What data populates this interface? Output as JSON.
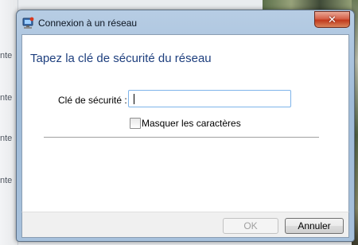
{
  "dialog": {
    "title": "Connexion à un réseau",
    "close_symbol": "✕",
    "heading": "Tapez la clé de sécurité du réseau",
    "security_key": {
      "label": "Clé de sécurité :",
      "value": "",
      "placeholder": ""
    },
    "hide_characters": {
      "label": "Masquer les caractères",
      "checked": false
    },
    "buttons": {
      "ok": "OK",
      "cancel": "Annuler"
    }
  },
  "background": {
    "left_snippets": [
      "nte",
      "nte",
      "nte",
      "nte"
    ]
  },
  "colors": {
    "heading": "#1e3f7e",
    "close_button": "#c0391c",
    "input_border": "#7eb4ea"
  },
  "icons": {
    "title": "network-connection-icon",
    "close": "close-icon"
  }
}
